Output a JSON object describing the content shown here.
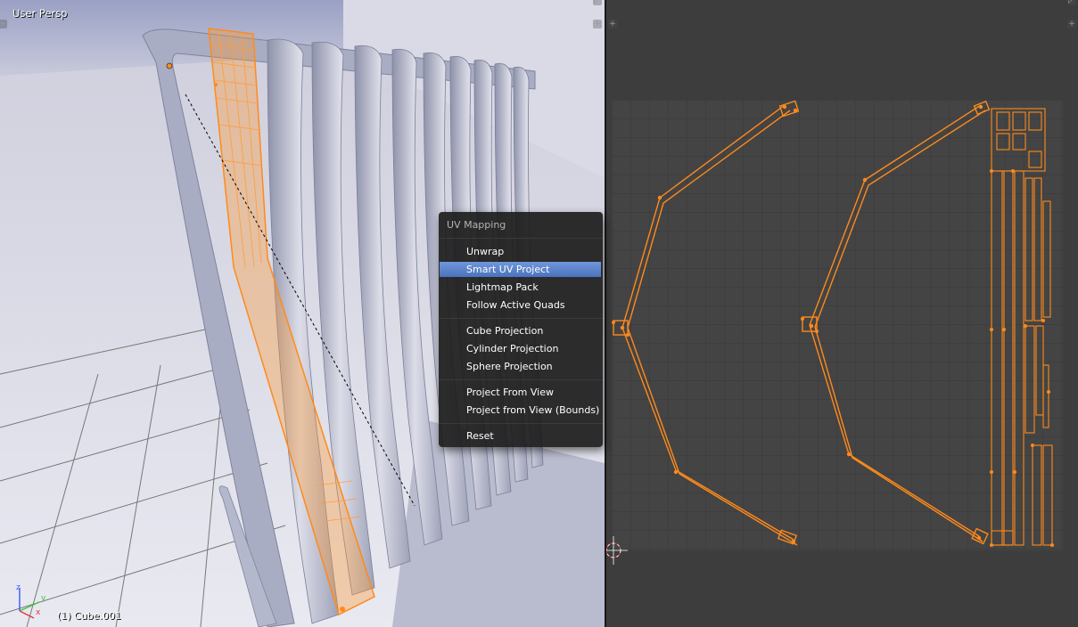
{
  "viewport": {
    "title": "User Persp",
    "status": "(1) Cube.001",
    "axes": {
      "x": "x",
      "y": "y",
      "z": "z"
    }
  },
  "menu": {
    "title": "UV Mapping",
    "items": [
      {
        "label": "Unwrap",
        "active": false
      },
      {
        "label": "Smart UV Project",
        "active": true
      },
      {
        "label": "Lightmap Pack",
        "active": false
      },
      {
        "label": "Follow Active Quads",
        "active": false
      },
      {
        "label": "Cube Projection",
        "active": false
      },
      {
        "label": "Cylinder Projection",
        "active": false
      },
      {
        "label": "Sphere Projection",
        "active": false
      },
      {
        "label": "Project From View",
        "active": false
      },
      {
        "label": "Project from View (Bounds)",
        "active": false
      },
      {
        "label": "Reset",
        "active": false
      }
    ]
  },
  "colors": {
    "accent_orange": "#ff8a1c",
    "menu_highlight": "#5680c2",
    "editor_bg": "#3d3d3d",
    "grid_bg": "#444444"
  },
  "icons": [
    "plus-icon",
    "axis-gizmo-icon",
    "2d-cursor-icon"
  ]
}
